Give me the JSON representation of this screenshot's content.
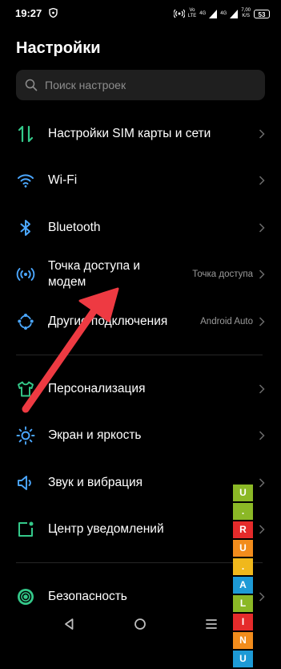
{
  "status_bar": {
    "time": "19:27",
    "net_1": "Vo\nLTE",
    "net_2": "4G",
    "net_3": "4G",
    "speed": "7,00\nK/S",
    "battery": "53"
  },
  "header": {
    "title": "Настройки"
  },
  "search": {
    "placeholder": "Поиск настроек"
  },
  "items": [
    {
      "label": "Настройки SIM карты и сети",
      "value": "",
      "icon": "sim-network-icon"
    },
    {
      "label": "Wi-Fi",
      "value": "",
      "icon": "wifi-icon"
    },
    {
      "label": "Bluetooth",
      "value": "",
      "icon": "bluetooth-icon"
    },
    {
      "label": "Точка доступа и\nмодем",
      "value": "Точка доступа",
      "icon": "hotspot-icon"
    },
    {
      "label": "Другие подключения",
      "value": "Android Auto",
      "icon": "connections-icon"
    },
    {
      "label": "Персонализация",
      "value": "",
      "icon": "personalization-icon"
    },
    {
      "label": "Экран и яркость",
      "value": "",
      "icon": "brightness-icon"
    },
    {
      "label": "Звук и вибрация",
      "value": "",
      "icon": "sound-icon"
    },
    {
      "label": "Центр уведомлений",
      "value": "",
      "icon": "notification-icon"
    },
    {
      "label": "Безопасность",
      "value": "",
      "icon": "security-icon"
    }
  ],
  "watermark": {
    "letters": [
      "U",
      ".",
      "R",
      "U",
      ".",
      "A",
      "L",
      "I",
      "N",
      "U"
    ]
  },
  "colors": {
    "accent_green": "#34c98a",
    "accent_blue": "#4ba7ff",
    "arrow_red": "#ee3a42"
  }
}
